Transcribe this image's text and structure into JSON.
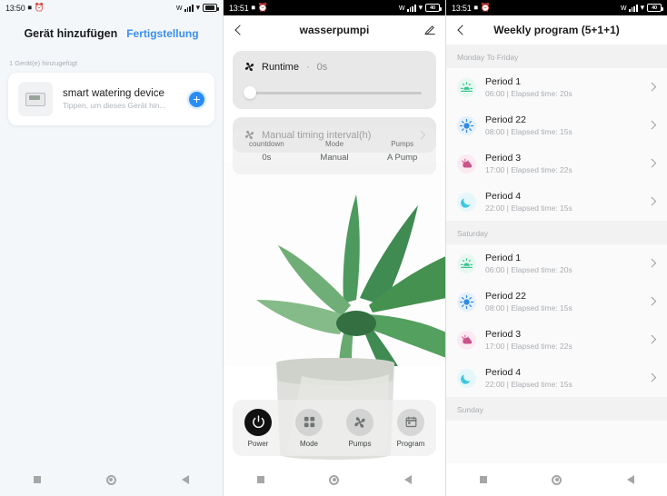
{
  "screens": [
    {
      "id": "add-device",
      "statusbar": {
        "time": "13:50",
        "icons": [
          "alarm-muted-icon",
          "alarm-clock-icon",
          "bluetooth-icon",
          "signal-icon",
          "wifi-icon",
          "battery-icon"
        ],
        "battery_label": ""
      },
      "header": {
        "title": "Gerät hinzufügen",
        "action": "Fertigstellung"
      },
      "subtitle": "1 Gerät(e) hinzugefügt",
      "device": {
        "name": "smart watering device",
        "hint": "Tippen, um dieses Gerät hin...",
        "add_label": "+"
      }
    },
    {
      "id": "device-control",
      "statusbar": {
        "time": "13:51",
        "icons": [
          "alarm-muted-icon",
          "alarm-clock-icon",
          "bluetooth-icon",
          "signal-icon",
          "wifi-icon",
          "battery-icon"
        ],
        "battery_label": "40"
      },
      "header": {
        "title": "wasserpumpi",
        "back": "back-icon",
        "edit": "pencil-icon"
      },
      "runtime": {
        "label": "Runtime",
        "separator": "·",
        "value": "0s",
        "slider_percent": 0
      },
      "manual_interval": {
        "label": "Manual timing interval(h)"
      },
      "status": [
        {
          "key": "countdown",
          "value": "0s"
        },
        {
          "key": "Mode",
          "value": "Manual"
        },
        {
          "key": "Pumps",
          "value": "A Pump"
        }
      ],
      "dock": [
        {
          "label": "Power",
          "icon": "power-icon",
          "active": true
        },
        {
          "label": "Mode",
          "icon": "grid-icon",
          "active": false
        },
        {
          "label": "Pumps",
          "icon": "fan-icon",
          "active": false
        },
        {
          "label": "Program",
          "icon": "calendar-icon",
          "active": false
        }
      ]
    },
    {
      "id": "weekly-program",
      "statusbar": {
        "time": "13:51",
        "icons": [
          "alarm-muted-icon",
          "alarm-clock-icon",
          "bluetooth-icon",
          "signal-icon",
          "wifi-icon",
          "battery-icon"
        ],
        "battery_label": "40"
      },
      "header": {
        "title": "Weekly program (5+1+1)",
        "back": "back-icon"
      },
      "groups": [
        {
          "day": "Monday To Friday",
          "periods": [
            {
              "name": "Period 1",
              "meta": "06:00  |  Elapsed time: 20s",
              "icon": "sunrise-icon",
              "color": "#35c48d"
            },
            {
              "name": "Period 22",
              "meta": "08:00  |  Elapsed time: 15s",
              "icon": "sun-icon",
              "color": "#2f8ae0"
            },
            {
              "name": "Period 3",
              "meta": "17:00  |  Elapsed time: 22s",
              "icon": "sunset-icon",
              "color": "#e0629b"
            },
            {
              "name": "Period 4",
              "meta": "22:00  |  Elapsed time: 15s",
              "icon": "moon-icon",
              "color": "#3ec8dd"
            }
          ]
        },
        {
          "day": "Saturday",
          "periods": [
            {
              "name": "Period 1",
              "meta": "06:00  |  Elapsed time: 20s",
              "icon": "sunrise-icon",
              "color": "#35c48d"
            },
            {
              "name": "Period 22",
              "meta": "08:00  |  Elapsed time: 15s",
              "icon": "sun-icon",
              "color": "#2f8ae0"
            },
            {
              "name": "Period 3",
              "meta": "17:00  |  Elapsed time: 22s",
              "icon": "sunset-icon",
              "color": "#e0629b"
            },
            {
              "name": "Period 4",
              "meta": "22:00  |  Elapsed time: 15s",
              "icon": "moon-icon",
              "color": "#3ec8dd"
            }
          ]
        },
        {
          "day": "Sunday",
          "periods": []
        }
      ]
    }
  ],
  "navbar": {
    "recents": "square-icon",
    "home": "circle-icon",
    "back": "triangle-icon"
  },
  "colors": {
    "accent_blue": "#2a8cf5",
    "link_blue": "#3a8ef0",
    "card_grey": "#e8e8e8",
    "page_grey": "#f2f2f2"
  }
}
